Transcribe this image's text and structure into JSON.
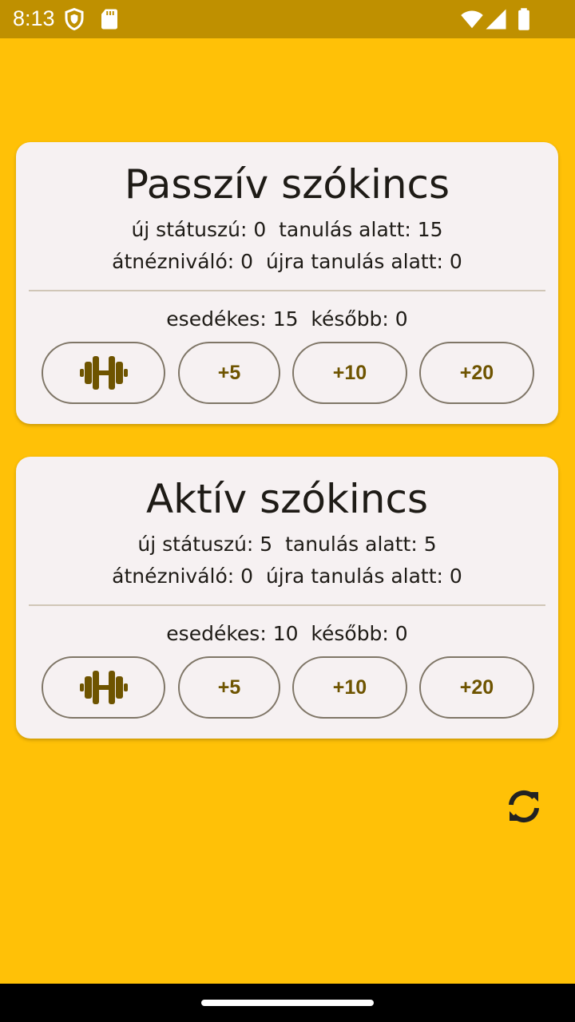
{
  "status_bar": {
    "time": "8:13",
    "icons": [
      "shield-icon",
      "sd-card-icon",
      "wifi-icon",
      "signal-icon",
      "battery-icon"
    ]
  },
  "colors": {
    "background": "#FFC107",
    "status_bar": "#BF9000",
    "card": "#F6F1F2",
    "accent": "#6E5400",
    "outline": "#7F7667"
  },
  "cards": [
    {
      "title": "Passzív szókincs",
      "line1": "új státuszú: 0  tanulás alatt: 15",
      "line2": "átnézniváló: 0  újra tanulás alatt: 0",
      "line3": "esedékes: 15  később: 0",
      "buttons": {
        "train_icon": "dumbbell-icon",
        "plus5": "+5",
        "plus10": "+10",
        "plus20": "+20"
      }
    },
    {
      "title": "Aktív szókincs",
      "line1": "új státuszú: 5  tanulás alatt: 5",
      "line2": "átnézniváló: 0  újra tanulás alatt: 0",
      "line3": "esedékes: 10  később: 0",
      "buttons": {
        "train_icon": "dumbbell-icon",
        "plus5": "+5",
        "plus10": "+10",
        "plus20": "+20"
      }
    }
  ],
  "refresh_icon": "refresh-icon"
}
